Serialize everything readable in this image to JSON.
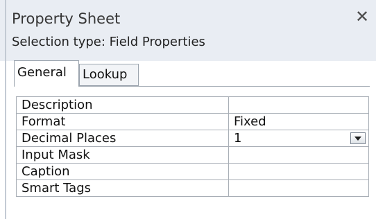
{
  "header": {
    "title": "Property Sheet",
    "close_glyph": "✕",
    "selection_type_label": "Selection type:  Field Properties"
  },
  "tabs": [
    {
      "label": "General",
      "selected": true
    },
    {
      "label": "Lookup",
      "selected": false
    }
  ],
  "properties": [
    {
      "name": "Description",
      "value": ""
    },
    {
      "name": "Format",
      "value": "Fixed"
    },
    {
      "name": "Decimal Places",
      "value": "1",
      "has_dropdown": true
    },
    {
      "name": "Input Mask",
      "value": ""
    },
    {
      "name": "Caption",
      "value": ""
    },
    {
      "name": "Smart Tags",
      "value": ""
    }
  ],
  "colors": {
    "header_bg": "#e9edf3",
    "grid_border": "#a8aeb6"
  },
  "icons": {
    "close": "close-icon",
    "dropdown": "chevron-down-icon"
  }
}
